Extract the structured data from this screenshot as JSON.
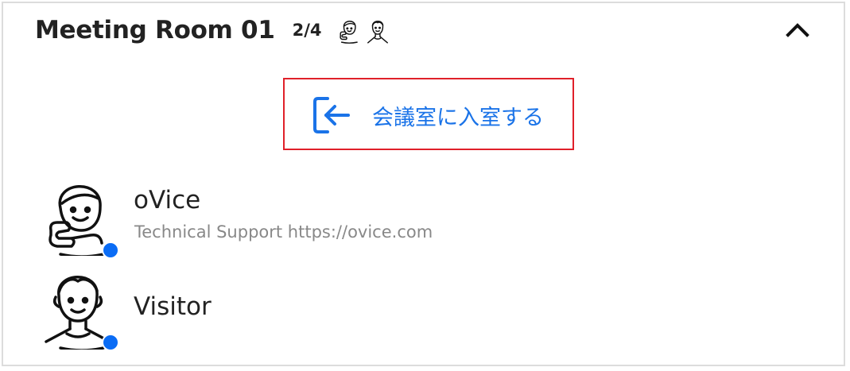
{
  "room": {
    "title": "Meeting Room 01",
    "occupancy": "2/4"
  },
  "icons": {
    "collapse": "chevron-up-icon",
    "enter": "enter-room-icon"
  },
  "enter_button": {
    "label": "会議室に入室する"
  },
  "members": [
    {
      "name": "oVice",
      "subtitle": "Technical Support https://ovice.com",
      "status": "online"
    },
    {
      "name": "Visitor",
      "subtitle": "",
      "status": "online"
    }
  ],
  "colors": {
    "accent": "#1a73e8",
    "status_online": "#0a6cf5",
    "highlight_border": "#e0202a",
    "panel_border": "#dcdcdc"
  }
}
